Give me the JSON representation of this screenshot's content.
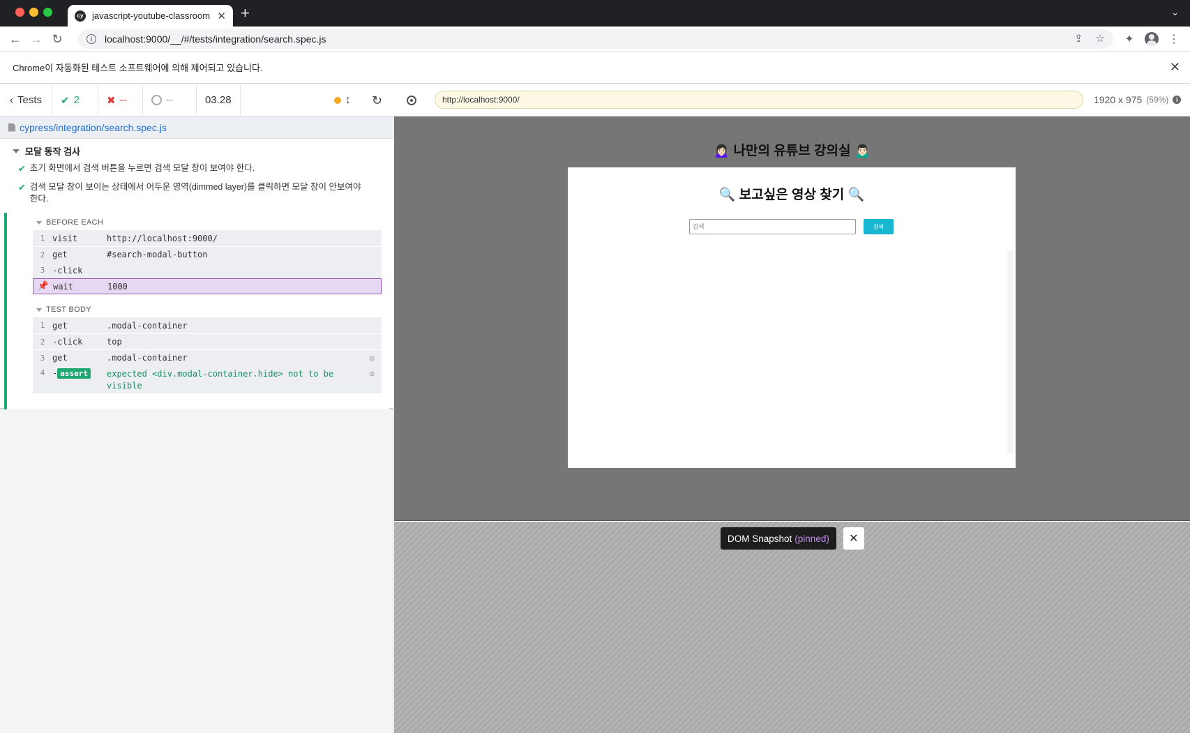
{
  "browser": {
    "tab_title": "javascript-youtube-classroom",
    "tab_favicon": "cy",
    "url": "localhost:9000/__/#/tests/integration/search.spec.js",
    "automation_notice": "Chrome이 자동화된 테스트 소프트웨어에 의해 제어되고 있습니다."
  },
  "reporter": {
    "back_label": "Tests",
    "passed": "2",
    "failed": "--",
    "pending": "--",
    "duration": "03.28",
    "spec_path": "cypress/integration/search.spec.js",
    "suite_title": "모달 동작 검사",
    "tests": [
      {
        "title": "초기 화면에서 검색 버튼을 누르면 검색 모달 창이 보여야 한다."
      },
      {
        "title": "검색 모달 창이 보이는 상태에서 어두운 영역(dimmed layer)를 클릭하면 모달 창이 안보여야 한다."
      }
    ],
    "before_each": {
      "label": "BEFORE EACH",
      "commands": [
        {
          "num": "1",
          "name": "visit",
          "msg": "http://localhost:9000/"
        },
        {
          "num": "2",
          "name": "get",
          "msg": "#search-modal-button"
        },
        {
          "num": "3",
          "name": " -click",
          "msg": ""
        },
        {
          "num": "",
          "name": "wait",
          "msg": "1000"
        }
      ]
    },
    "test_body": {
      "label": "TEST BODY",
      "commands": [
        {
          "num": "1",
          "name": "get",
          "msg": ".modal-container"
        },
        {
          "num": "2",
          "name": " -click",
          "msg": "top"
        },
        {
          "num": "3",
          "name": "get",
          "msg": ".modal-container"
        },
        {
          "num": "4",
          "name_prefix": " -",
          "badge": "assert",
          "msg": "expected <div.modal-container.hide> not to be visible"
        }
      ]
    }
  },
  "aut": {
    "url": "http://localhost:9000/",
    "viewport": "1920 x 975",
    "scale": "(59%)",
    "app_title": "🙍🏻‍♀️ 나만의 유튜브 강의실 🙍🏻‍♂️",
    "modal_title": "🔍 보고싶은 영상 찾기 🔍",
    "search_placeholder": "검색",
    "search_button": "검색",
    "snapshot_label": "DOM Snapshot",
    "snapshot_state": "(pinned)"
  }
}
